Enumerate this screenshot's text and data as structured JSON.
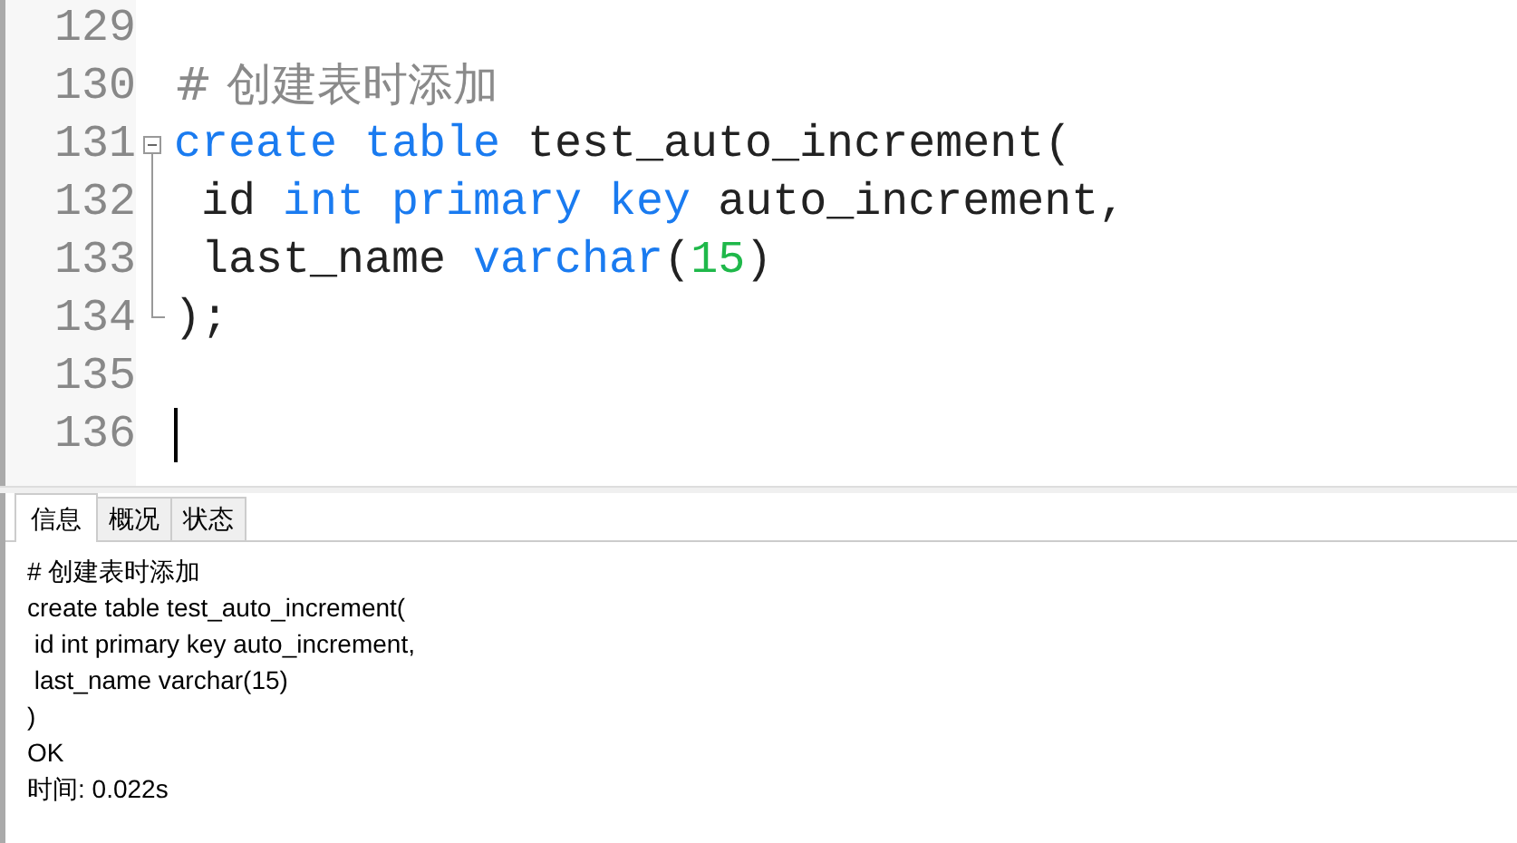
{
  "editor": {
    "lines": [
      {
        "number": "129",
        "in_fold_block": false,
        "cursor": false
      },
      {
        "number": "130",
        "in_fold_block": false,
        "cursor": false,
        "tokens": [
          {
            "text": "# 创建表时添加",
            "kind": "comment"
          }
        ]
      },
      {
        "number": "131",
        "in_fold_block": true,
        "cursor": false,
        "tokens": [
          {
            "text": "create table",
            "kind": "keyword"
          },
          {
            "text": " test_auto_increment(",
            "kind": "plain"
          }
        ]
      },
      {
        "number": "132",
        "in_fold_block": true,
        "cursor": false,
        "tokens": [
          {
            "text": " id ",
            "kind": "plain"
          },
          {
            "text": "int primary key",
            "kind": "keyword"
          },
          {
            "text": " auto_increment,",
            "kind": "plain"
          }
        ]
      },
      {
        "number": "133",
        "in_fold_block": true,
        "cursor": false,
        "tokens": [
          {
            "text": " last_name ",
            "kind": "plain"
          },
          {
            "text": "varchar",
            "kind": "keyword"
          },
          {
            "text": "(",
            "kind": "plain"
          },
          {
            "text": "15",
            "kind": "number"
          },
          {
            "text": ")",
            "kind": "plain"
          }
        ]
      },
      {
        "number": "134",
        "in_fold_block": true,
        "cursor": false,
        "tokens": [
          {
            "text": ");",
            "kind": "plain"
          }
        ]
      },
      {
        "number": "135",
        "in_fold_block": false,
        "cursor": false
      },
      {
        "number": "136",
        "in_fold_block": false,
        "cursor": true
      }
    ]
  },
  "panel": {
    "tabs": [
      {
        "label": "信息",
        "selected": true
      },
      {
        "label": "概况",
        "selected": false
      },
      {
        "label": "状态",
        "selected": false
      }
    ],
    "messages": [
      "# 创建表时添加",
      "create table test_auto_increment(",
      " id int primary key auto_increment,",
      " last_name varchar(15)",
      ")",
      "OK",
      "时间: 0.022s"
    ]
  }
}
